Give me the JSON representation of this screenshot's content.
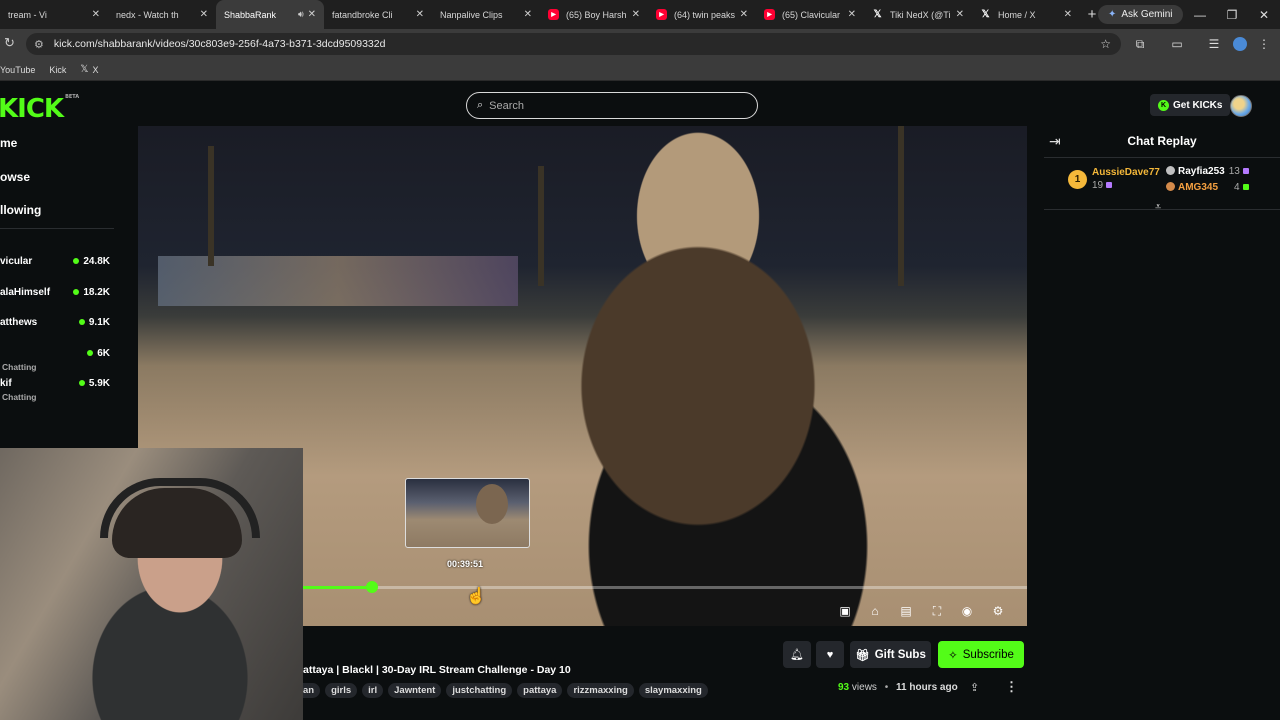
{
  "browser": {
    "tabs": [
      {
        "label": "tream - Vi",
        "favicon": "none",
        "active": false
      },
      {
        "label": "nedx - Watch th",
        "favicon": "kick",
        "active": false
      },
      {
        "label": "ShabbaRank",
        "favicon": "kick",
        "active": true,
        "audio": true
      },
      {
        "label": "fatandbroke Cli",
        "favicon": "kick",
        "active": false
      },
      {
        "label": "Nanpalive Clips",
        "favicon": "kick",
        "active": false
      },
      {
        "label": "(65) Boy Harsh",
        "favicon": "youtube",
        "active": false
      },
      {
        "label": "(64) twin peaks",
        "favicon": "youtube",
        "active": false
      },
      {
        "label": "(65) Clavicular",
        "favicon": "youtube",
        "active": false
      },
      {
        "label": "Tiki NedX (@Ti",
        "favicon": "x",
        "active": false
      },
      {
        "label": "Home / X",
        "favicon": "x",
        "active": false
      }
    ],
    "new_tab_icon": "+",
    "gemini_label": "Ask Gemini",
    "url": "kick.com/shabbarank/videos/30c803e9-256f-4a73-b371-3dcd9509332d",
    "bookmarks": [
      {
        "label": "YouTube",
        "favicon": "none"
      },
      {
        "label": "Kick",
        "favicon": "kick"
      },
      {
        "label": "X",
        "favicon": "x"
      }
    ]
  },
  "kick": {
    "logo": "KICK",
    "logo_badge": "BETA",
    "search_placeholder": "Search",
    "get_kicks_label": "Get KICKs",
    "nav": [
      {
        "label": "me"
      },
      {
        "label": "owse"
      },
      {
        "label": "llowing"
      }
    ],
    "channels": [
      {
        "name": "vicular",
        "viewers": "24.8K",
        "category": ""
      },
      {
        "name": "alaHimself",
        "viewers": "18.2K",
        "category": ""
      },
      {
        "name": "atthews",
        "viewers": "9.1K",
        "category": ""
      },
      {
        "name": "",
        "viewers": "6K",
        "category": "Chatting"
      },
      {
        "name": "kif",
        "viewers": "5.9K",
        "category": "Chatting"
      }
    ],
    "player": {
      "preview_time": "00:39:51",
      "progress": 0.263
    },
    "chat": {
      "title": "Chat Replay",
      "leaders": [
        {
          "rank": "1",
          "name": "AussieDave77",
          "count": "19",
          "name_color": "#f5b83a"
        },
        {
          "name": "Rayfia253",
          "count": "13",
          "name_color": "#ffffff"
        },
        {
          "name": "AMG345",
          "count": "4",
          "name_color": "#f5a040"
        }
      ]
    },
    "video": {
      "title": "attaya | Blackl | 30-Day IRL Stream Challenge - Day 10",
      "tags": [
        "an",
        "girls",
        "irl",
        "Jawntent",
        "justchatting",
        "pattaya",
        "rizzmaxxing",
        "slaymaxxing"
      ],
      "gift_subs_label": "Gift Subs",
      "subscribe_label": "Subscribe",
      "views_count": "93",
      "views_label": "views",
      "time_ago": "11 hours ago"
    }
  }
}
